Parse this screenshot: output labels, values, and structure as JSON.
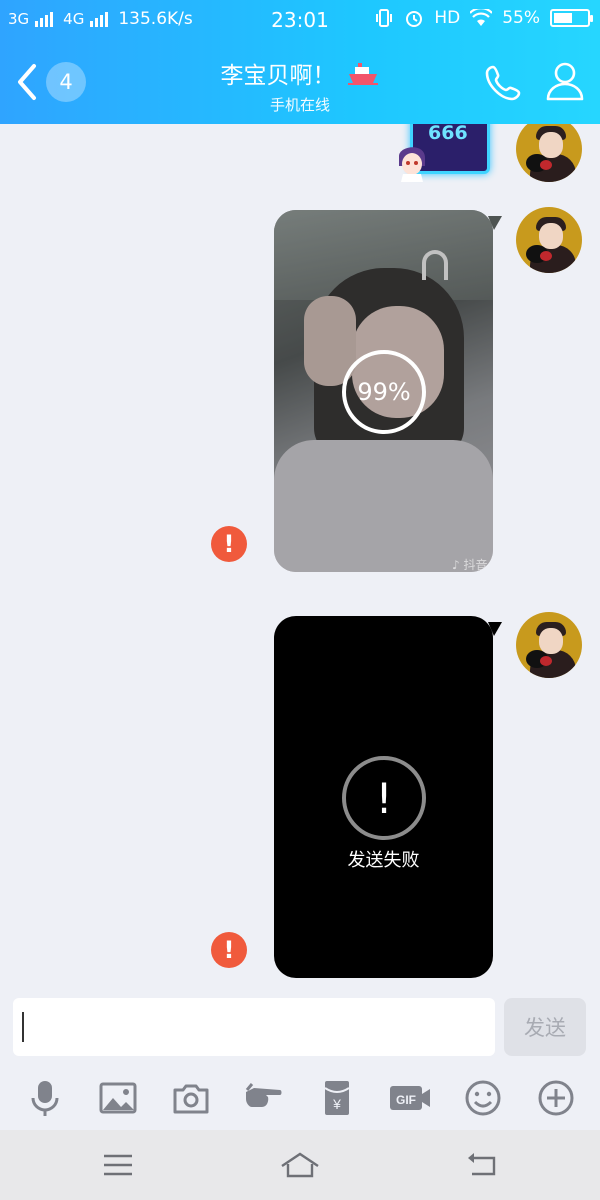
{
  "status_bar": {
    "network1": "3G",
    "network2": "4G",
    "speed": "135.6K/s",
    "time": "23:01",
    "hd": "HD",
    "battery": "55%",
    "battery_level": 0.55
  },
  "header": {
    "unread_count": "4",
    "contact_name": "李宝贝啊！",
    "contact_status": "手机在线"
  },
  "messages": [
    {
      "type": "sticker",
      "text": "666"
    },
    {
      "type": "video",
      "progress": "99%",
      "watermark": "♪ 抖音"
    },
    {
      "type": "video",
      "status_text": "发送失败"
    }
  ],
  "input": {
    "placeholder": "",
    "value": "",
    "send_label": "发送"
  },
  "toolbar": {
    "items": [
      "mic-icon",
      "image-icon",
      "camera-icon",
      "poke-icon",
      "red-packet-icon",
      "gif-icon",
      "emoji-icon",
      "plus-icon"
    ],
    "gif_label": "GIF",
    "redpacket_symbol": "¥"
  },
  "colors": {
    "header_start": "#2fa4ff",
    "header_end": "#26d6ff",
    "error": "#f05a3c",
    "background": "#eef0f6"
  }
}
